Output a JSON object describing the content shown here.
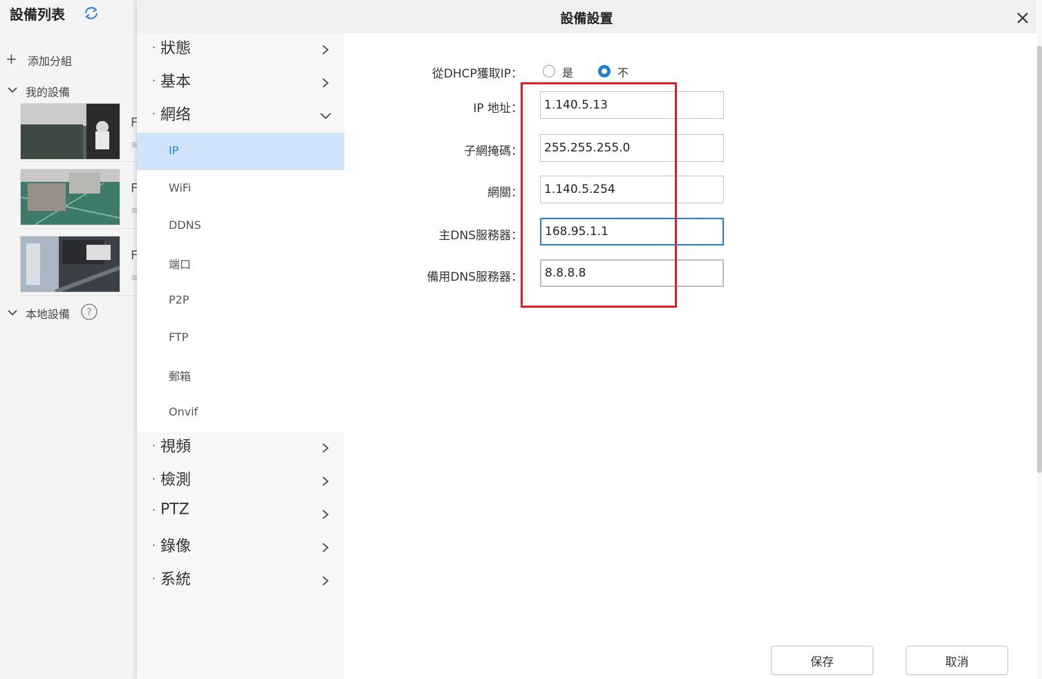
{
  "background_app": {
    "title": "設備列表",
    "add_group": "添加分組",
    "my_devices": "我的設備",
    "local_devices": "本地設備",
    "device_letter": "F"
  },
  "dialog": {
    "title": "設備設置",
    "nav": {
      "status": "狀態",
      "basic": "基本",
      "network": "網络",
      "network_items": [
        "IP",
        "WiFi",
        "DDNS",
        "端口",
        "P2P",
        "FTP",
        "郵箱",
        "Onvif"
      ],
      "video": "視頻",
      "detection": "檢測",
      "ptz": "PTZ",
      "record": "錄像",
      "system": "系統"
    },
    "form": {
      "dhcp_label": "從DHCP獲取IP：",
      "dhcp_yes": "是",
      "dhcp_no": "不",
      "dhcp_selected": "不",
      "ip_label": "IP 地址：",
      "ip_value": "1.140.5.13",
      "subnet_label": "子網掩碼：",
      "subnet_value": "255.255.255.0",
      "gateway_label": "網關：",
      "gateway_value": "1.140.5.254",
      "dns1_label": "主DNS服務器：",
      "dns1_value": "168.95.1.1",
      "dns2_label": "備用DNS服務器：",
      "dns2_value": "8.8.8.8"
    },
    "buttons": {
      "save": "保存",
      "cancel": "取消"
    }
  },
  "colors": {
    "accent": "#1e7fd8",
    "selected_bg": "#cfe4fb",
    "highlight_red": "#e01b24"
  }
}
